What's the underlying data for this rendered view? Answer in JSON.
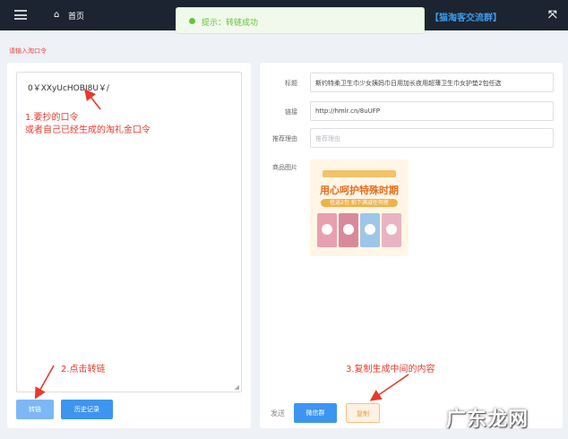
{
  "topbar": {
    "home_label": "首页",
    "group_link": "【猫淘客交流群】"
  },
  "toast": {
    "message": "提示：转链成功",
    "color": "#67c23a"
  },
  "instruction": "请输入淘口令",
  "left_panel": {
    "code_value": "0￥XXyUcHOBJ8U￥/",
    "convert_button": "转链",
    "history_button": "历史记录"
  },
  "right_panel": {
    "title_label": "标题",
    "title_value": "斯约特柔卫生巾少女姨妈巾日用加长夜用超薄卫生巾女护垫2包任选",
    "link_label": "链接",
    "link_value": "http://hmlr.cn/8uUFP",
    "reason_label": "推荐理由",
    "reason_placeholder": "推荐理由",
    "image_label": "商品图片",
    "image": {
      "headline": "用心呵护特殊时期",
      "subline": "任选2包 拍下满减任何搭"
    },
    "send_label": "发送",
    "wechat_button": "微信群",
    "copy_button": "复制"
  },
  "annotations": {
    "note1_line1": "1.要抄的口令",
    "note1_line2": "或者自己已经生成的淘礼金口令",
    "note2": "2.点击转链",
    "note3": "3.复制生成中间的内容",
    "color": "#e8392b"
  },
  "watermark": "广东龙网",
  "colors": {
    "topbar": "#1b2430",
    "primary": "#3d95f0",
    "group_link": "#3d9be9"
  }
}
